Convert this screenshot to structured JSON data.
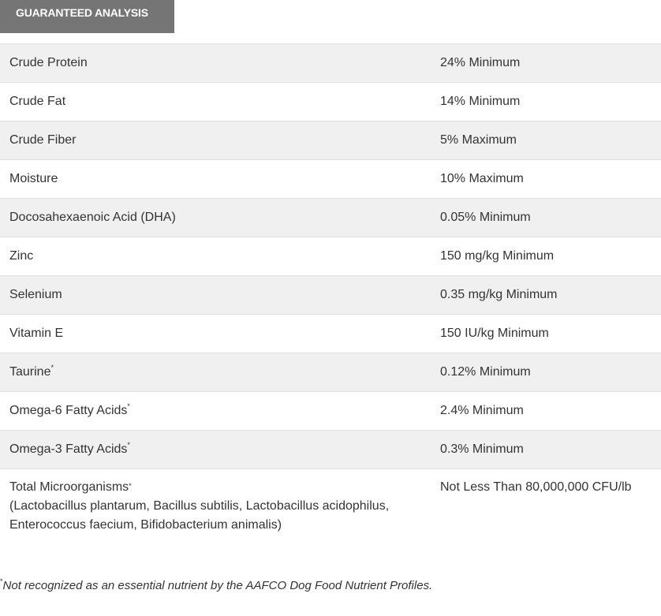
{
  "header": {
    "tab_label": "GUARANTEED ANALYSIS"
  },
  "rows": [
    {
      "name": "Crude Protein",
      "value": "24% Minimum"
    },
    {
      "name": "Crude Fat",
      "value": "14% Minimum"
    },
    {
      "name": "Crude Fiber",
      "value": "5% Maximum"
    },
    {
      "name": "Moisture",
      "value": "10% Maximum"
    },
    {
      "name": "Docosahexaenoic Acid (DHA)",
      "value": "0.05% Minimum"
    },
    {
      "name": "Zinc",
      "value": "150 mg/kg Minimum"
    },
    {
      "name": "Selenium",
      "value": "0.35 mg/kg Minimum"
    },
    {
      "name": "Vitamin E",
      "value": "150 IU/kg Minimum"
    },
    {
      "name": "Taurine",
      "marker": "*",
      "value": "0.12% Minimum"
    },
    {
      "name": "Omega-6 Fatty Acids",
      "marker": "*",
      "value": "2.4% Minimum"
    },
    {
      "name": "Omega-3 Fatty Acids",
      "marker": "*",
      "value": "0.3% Minimum"
    },
    {
      "name": "Total Microorganisms",
      "marker": "*",
      "detail_line1": "(Lactobacillus plantarum, Bacillus subtilis, Lactobacillus acidophilus,",
      "detail_line2": "Enterococcus faecium, Bifidobacterium animalis)",
      "value": "Not Less Than 80,000,000 CFU/lb"
    }
  ],
  "footnote": {
    "marker": "*",
    "text": "Not recognized as an essential nutrient by the AAFCO Dog Food Nutrient Profiles."
  }
}
